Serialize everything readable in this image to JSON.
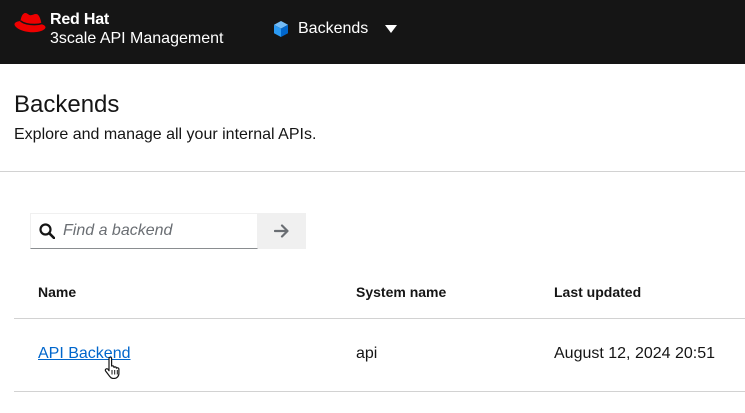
{
  "masthead": {
    "brand_name": "Red Hat",
    "product_name": "3scale API Management",
    "context_label": "Backends",
    "colors": {
      "background": "#151515",
      "brand_red": "#ee0000",
      "context_icon": "#2b9af3"
    }
  },
  "page_header": {
    "title": "Backends",
    "description": "Explore and manage all your internal APIs."
  },
  "search": {
    "placeholder": "Find a backend",
    "value": ""
  },
  "table": {
    "columns": [
      "Name",
      "System name",
      "Last updated"
    ],
    "rows": [
      {
        "name": "API Backend",
        "system_name": "api",
        "last_updated": "August 12, 2024 20:51"
      }
    ]
  },
  "icons": {
    "brand": "red-hat-fedora-icon",
    "context": "cube-icon",
    "context_toggle": "caret-down-icon",
    "search": "search-icon",
    "submit": "arrow-right-icon",
    "pointer": "hand-pointer-icon"
  },
  "colors": {
    "link": "#0066cc",
    "border": "#d2d2d2",
    "search_button_bg": "#f0f0f0"
  }
}
